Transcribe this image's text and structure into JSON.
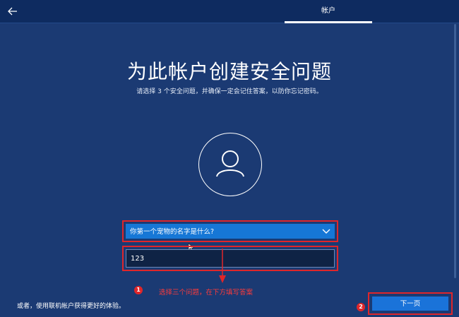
{
  "header": {
    "tab_label": "帐户"
  },
  "main": {
    "title": "为此帐户创建安全问题",
    "subtitle": "请选择 3 个安全问题，并确保一定会记住答案，以防你忘记密码。"
  },
  "form": {
    "question_selected": "你第一个宠物的名字是什么?",
    "answer_value": "123"
  },
  "annotations": {
    "badge_1": "1",
    "badge_2": "2",
    "hint": "选择三个问题，在下方填写答案",
    "highlight_color": "#e0262a"
  },
  "footer": {
    "alt_link": "或者，使用联机帐户获得更好的体验。",
    "next_label": "下一页"
  },
  "colors": {
    "background": "#1b3a73",
    "accent": "#1677d6"
  },
  "icons": {
    "back": "arrow-left-icon",
    "avatar": "user-icon",
    "dropdown": "chevron-down-icon"
  }
}
